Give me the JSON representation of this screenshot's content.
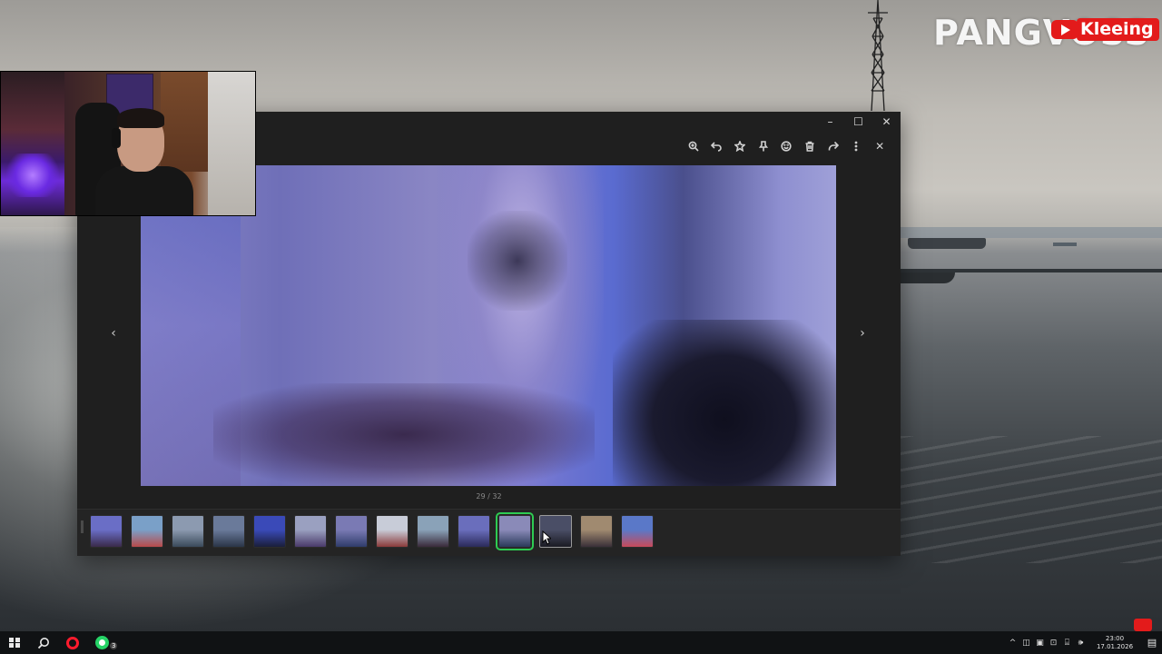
{
  "channel": {
    "name": "PANGVOSS",
    "creator_badge": "Kleeing"
  },
  "viewer": {
    "window_controls": {
      "minimize": "–",
      "maximize": "☐",
      "close": "✕"
    },
    "toolbar": {
      "zoom": "zoom-in-icon",
      "undo": "undo-icon",
      "favorite": "star-icon",
      "pin": "pin-icon",
      "reaction": "emoji-icon",
      "delete": "trash-icon",
      "share": "share-icon",
      "more": "more-icon",
      "close": "✕"
    },
    "nav_prev": "‹",
    "nav_next": "›",
    "counter": "29 / 32",
    "thumbnails": [
      {
        "c1": "#6a6ec6",
        "c2": "#3a2a4a"
      },
      {
        "c1": "#7aa0c8",
        "c2": "#b94a4a"
      },
      {
        "c1": "#8c9ab0",
        "c2": "#3a4a5a"
      },
      {
        "c1": "#6a7a9a",
        "c2": "#2a3548"
      },
      {
        "c1": "#3a4ab8",
        "c2": "#1a1e3a"
      },
      {
        "c1": "#9aa0c0",
        "c2": "#4a3a6a"
      },
      {
        "c1": "#7a7ab4",
        "c2": "#2f3c6a"
      },
      {
        "c1": "#c8ccd8",
        "c2": "#8a3a3a"
      },
      {
        "c1": "#8aa2b8",
        "c2": "#3a2a3a"
      },
      {
        "c1": "#6a6ebc",
        "c2": "#2a2a5a"
      },
      {
        "c1": "#8a8ab8",
        "c2": "#2a3a5a"
      },
      {
        "c1": "#4a4e66",
        "c2": "#1a1a22"
      },
      {
        "c1": "#a08a70",
        "c2": "#3a3038"
      },
      {
        "c1": "#5a78c8",
        "c2": "#c84a5a"
      }
    ],
    "active_index": 10,
    "hover_index": 11
  },
  "taskbar": {
    "start": "windows-icon",
    "search": "search-icon",
    "apps": [
      {
        "name": "opera-icon"
      },
      {
        "name": "whatsapp-icon",
        "badge": "3"
      }
    ],
    "tray": {
      "chevron": "^",
      "time": "23:00",
      "date": "17.01.2026"
    }
  }
}
